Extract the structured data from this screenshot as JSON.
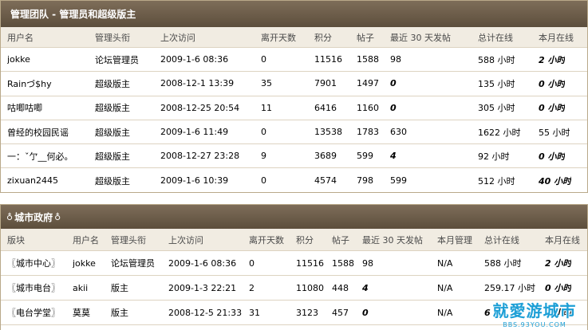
{
  "panel1": {
    "title": "管理团队 - 管理员和超级版主",
    "headers": [
      "用户名",
      "管理头衔",
      "上次访问",
      "离开天数",
      "积分",
      "帖子",
      "最近 30 天发帖",
      "总计在线",
      "本月在线"
    ],
    "rows": [
      [
        "jokke",
        "论坛管理员",
        "2009-1-6 08:36",
        "0",
        "11516",
        "1588",
        "98",
        "588 小时",
        "2 小时"
      ],
      [
        "Rainづ$hy",
        "超级版主",
        "2008-12-1 13:39",
        "35",
        "7901",
        "1497",
        "0",
        "135 小时",
        "0 小时"
      ],
      [
        "咕唧咕唧",
        "超级版主",
        "2008-12-25 20:54",
        "11",
        "6416",
        "1160",
        "0",
        "305 小时",
        "0 小时"
      ],
      [
        "曾经的校园民谣",
        "超级版主",
        "2009-1-6 11:49",
        "0",
        "13538",
        "1783",
        "630",
        "1622 小时",
        "55 小时"
      ],
      [
        "一：ˇ亇__何必。",
        "超级版主",
        "2008-12-27 23:28",
        "9",
        "3689",
        "599",
        "4",
        "92 小时",
        "0 小时"
      ],
      [
        "zixuan2445",
        "超级版主",
        "2009-1-6 10:39",
        "0",
        "4574",
        "798",
        "599",
        "512 小时",
        "40 小时"
      ]
    ]
  },
  "panel2": {
    "title_icon": "♁",
    "title": "城市政府",
    "headers": [
      "版块",
      "用户名",
      "管理头衔",
      "上次访问",
      "离开天数",
      "积分",
      "帖子",
      "最近 30 天发帖",
      "本月管理",
      "总计在线",
      "本月在线"
    ],
    "rows": [
      [
        "〖城市中心〗",
        "jokke",
        "论坛管理员",
        "2009-1-6 08:36",
        "0",
        "11516",
        "1588",
        "98",
        "N/A",
        "588 小时",
        "2 小时"
      ],
      [
        "〖城市电台〗",
        "akii",
        "版主",
        "2009-1-3 22:21",
        "2",
        "11080",
        "448",
        "4",
        "N/A",
        "259.17 小时",
        "0 小时"
      ],
      [
        "〖电台学堂〗",
        "莫莫",
        "版主",
        "2008-12-5 21:33",
        "31",
        "3123",
        "457",
        "0",
        "N/A",
        "6",
        "0 小时"
      ]
    ]
  },
  "watermark": {
    "title": "就愛游城市",
    "url": "BBS.93YOU.COM"
  }
}
